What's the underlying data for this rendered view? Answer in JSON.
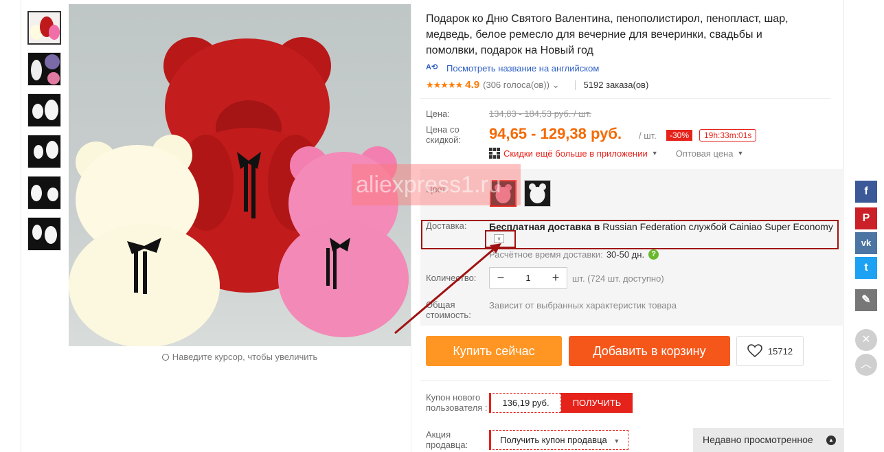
{
  "product": {
    "title": "Подарок ко Дню Святого Валентина, пенополистирол, пенопласт, шар, медведь, белое ремесло для вечерние для вечеринки, свадьбы и помолвки, подарок на Новый год",
    "translate_link": "Посмотреть название на английском",
    "rating": {
      "stars": "★★★★★",
      "score": "4.9",
      "votes": "(306 голоса(ов))",
      "orders": "5192 заказа(ов)"
    }
  },
  "gallery": {
    "zoom_hint": "Наведите курсор, чтобы увеличить"
  },
  "price": {
    "label": "Цена:",
    "old": "134,83 - 184,53 руб. / шт.",
    "discount_label": "Цена со скидкой:",
    "new": "94,65 - 129,38 руб.",
    "per": "/ шт.",
    "discount": "-30%",
    "timer": "19h:33m:01s",
    "app_discount": "Скидки ещё больше в приложении",
    "wholesale": "Оптовая цена"
  },
  "options": {
    "color_label": "Цвет:",
    "shipping_label": "Доставка:",
    "shipping_bold": "Бесплатная доставка в",
    "shipping_rest": " Russian Federation службой Cainiao Super Economy",
    "eta_label": "Расчётное время доставки:",
    "eta_value": "30-50 дн.",
    "qty_label": "Количество:",
    "qty_value": "1",
    "qty_unit": "шт. (724 шт. доступно)",
    "total_label": "Общая стоимость:",
    "total_note": "Зависит от выбранных характеристик товара"
  },
  "actions": {
    "buy_now": "Купить сейчас",
    "add_to_cart": "Добавить в корзину",
    "wishlist_count": "15712"
  },
  "coupons": {
    "new_user_label": "Купон нового пользователя :",
    "new_user_amount": "136,19 руб.",
    "get": "ПОЛУЧИТЬ",
    "seller_label": "Акция продавца:",
    "seller_button": "Получить купон продавца"
  },
  "recent": {
    "label": "Недавно просмотренное"
  },
  "watermark": "aliexpress1.ru",
  "social": {
    "facebook": "f",
    "pinterest": "P",
    "vk": "vk",
    "twitter": "t",
    "edit": "✎",
    "close": "✕",
    "up": "︿"
  }
}
